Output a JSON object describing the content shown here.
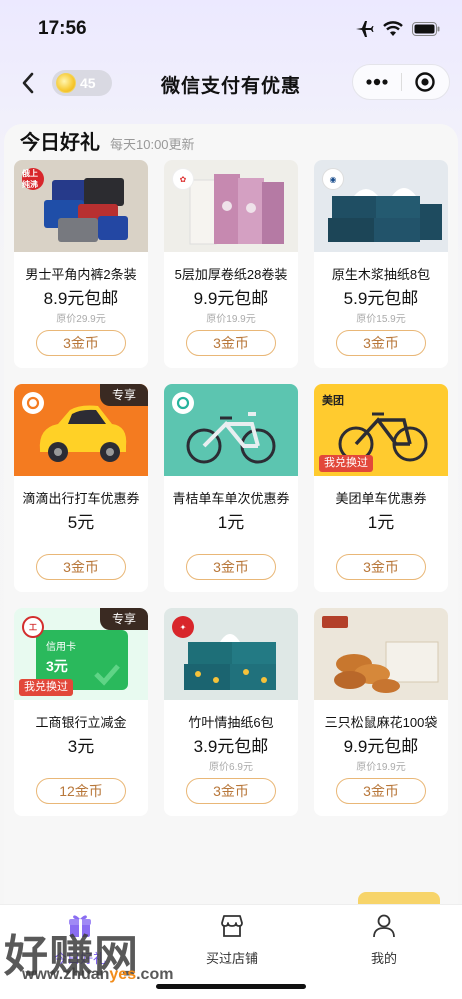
{
  "status_bar": {
    "time": "17:56"
  },
  "nav": {
    "coins": "45",
    "title": "微信支付有优惠"
  },
  "section": {
    "title": "今日好礼",
    "subtitle": "每天10:00更新"
  },
  "cards": [
    {
      "name": "男士平角内裤2条装",
      "price": "8.9元包邮",
      "original": "原价29.9元",
      "cost": "3金币",
      "brand_logo": "俄上 纯沸",
      "image": "underwear-photo"
    },
    {
      "name": "5层加厚卷纸28卷装",
      "price": "9.9元包邮",
      "original": "原价19.9元",
      "cost": "3金币",
      "brand_logo": "",
      "image": "toilet-paper-photo"
    },
    {
      "name": "原生木浆抽纸8包",
      "price": "5.9元包邮",
      "original": "原价15.9元",
      "cost": "3金币",
      "brand_logo": "",
      "image": "tissue-box-photo"
    },
    {
      "name": "滴滴出行打车优惠券",
      "price": "5元",
      "original": "",
      "cost": "3金币",
      "badge": "专享",
      "image": "didi-car"
    },
    {
      "name": "青桔单车单次优惠券",
      "price": "1元",
      "original": "",
      "cost": "3金币",
      "image": "qingju-bike"
    },
    {
      "name": "美团单车优惠券",
      "price": "1元",
      "original": "",
      "cost": "3金币",
      "brand_logo": "美团",
      "redeemed": "我兑换过",
      "image": "meituan-bike"
    },
    {
      "name": "工商银行立减金",
      "price": "3元",
      "original": "",
      "cost": "12金币",
      "badge": "专享",
      "card_label": "信用卡",
      "card_amount": "3元",
      "redeemed": "我兑换过",
      "image": "icbc-card"
    },
    {
      "name": "竹叶情抽纸6包",
      "price": "3.9元包邮",
      "original": "原价6.9元",
      "cost": "3金币",
      "image": "bamboo-tissue-photo"
    },
    {
      "name": "三只松鼠麻花100袋",
      "price": "9.9元包邮",
      "original": "原价19.9元",
      "cost": "3金币",
      "image": "snack-photo"
    }
  ],
  "tabbar": {
    "tabs": [
      {
        "label": "今日好礼",
        "icon": "gift-icon"
      },
      {
        "label": "买过店铺",
        "icon": "store-icon"
      },
      {
        "label": "我的",
        "icon": "person-icon"
      }
    ]
  },
  "watermark": {
    "brand": "好赚网",
    "url_prefix": "www.zhuan",
    "url_accent": "yes",
    "url_suffix": ".com"
  },
  "colors": {
    "accent": "#7b5cf0",
    "price_button_border": "#e9b777",
    "exclusive_badge": "#3a2a22",
    "redeemed_badge": "#e2483a"
  }
}
